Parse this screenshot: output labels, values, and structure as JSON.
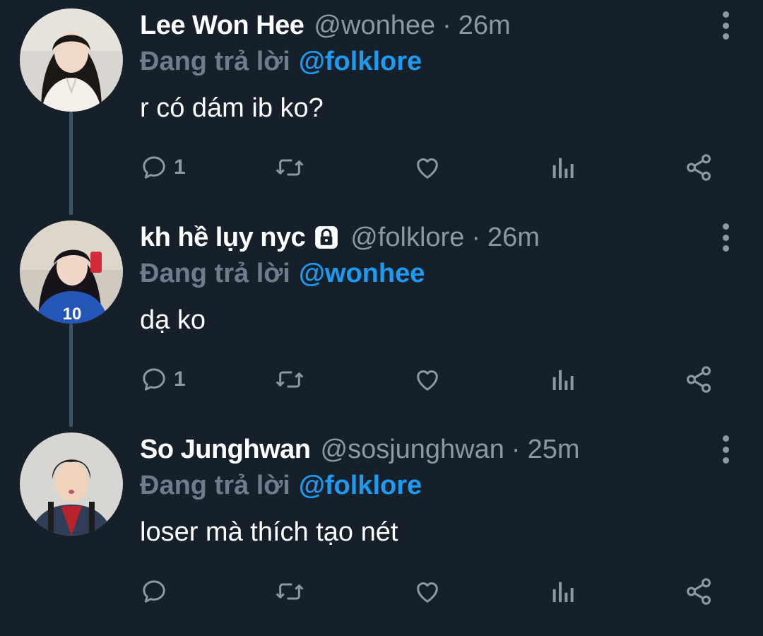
{
  "theme": {
    "background": "#15202b",
    "text_primary": "#ffffff",
    "text_secondary": "#8b98a5",
    "reply_label": "#6e7d8c",
    "mention": "#1d9bf0",
    "thread_line": "#3d5466"
  },
  "tweets": [
    {
      "display_name": "Lee Won Hee",
      "handle": "@wonhee",
      "separator": "·",
      "time": "26m",
      "protected": false,
      "reply_label": "Đang trả lời",
      "reply_to": "@folklore",
      "text": "r có dám ib ko?",
      "reply_count": "1",
      "icons": [
        "reply-icon",
        "retweet-icon",
        "like-icon",
        "views-icon",
        "share-icon",
        "more-icon"
      ]
    },
    {
      "display_name": "kh hề lụy nyc",
      "handle": "@folklore",
      "separator": "·",
      "time": "26m",
      "protected": true,
      "reply_label": "Đang trả lời",
      "reply_to": "@wonhee",
      "text": "dạ ko",
      "reply_count": "1",
      "icons": [
        "reply-icon",
        "retweet-icon",
        "like-icon",
        "views-icon",
        "share-icon",
        "more-icon",
        "lock-icon"
      ]
    },
    {
      "display_name": "So Junghwan",
      "handle": "@sosjunghwan",
      "separator": "·",
      "time": "25m",
      "protected": false,
      "reply_label": "Đang trả lời",
      "reply_to": "@folklore",
      "text": "loser mà thích tạo nét",
      "reply_count": "",
      "icons": [
        "reply-icon",
        "retweet-icon",
        "like-icon",
        "views-icon",
        "share-icon",
        "more-icon"
      ]
    }
  ]
}
